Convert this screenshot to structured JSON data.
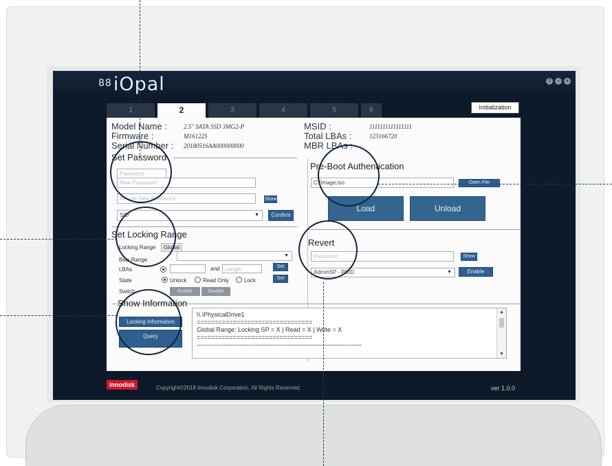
{
  "app": {
    "logo_text": "iOpal",
    "logo_glyph": "88"
  },
  "window_buttons": [
    "?",
    "−",
    "×"
  ],
  "tabs": [
    "1",
    "2",
    "3",
    "4",
    "5",
    "6"
  ],
  "initialization_label": "Initialization",
  "device_info": {
    "model_label": "Model Name :",
    "model_value": "2.5\" SATA SSD 3MG2-P",
    "firmware_label": "Firmware :",
    "firmware_value": "M161225",
    "serial_label": "Serial Number :",
    "serial_value": "20180516AA000000000",
    "msid_label": "MSID :",
    "msid_value": "1111111111111111",
    "lbas_label": "Total LBAs :",
    "lbas_value": "123166720",
    "mbr_label": "MBR LBAs :"
  },
  "set_password": {
    "title": "Set Password",
    "password_placeholder": "Password",
    "new_password_placeholder": "New Password",
    "retype_placeholder": "Retype New Password",
    "show_label": "Show",
    "authority_value": "SID",
    "confirm_label": "Confirm"
  },
  "pre_boot": {
    "title": "Pre-Boot Authentication",
    "path_value": "C:/Image.iso",
    "open_file_label": "Open File",
    "load_label": "Load",
    "unload_label": "Unload"
  },
  "locking_range": {
    "title": "Set Locking Range",
    "range_label": "Locking Range",
    "range_value": "Global",
    "bias_label": "Bias Range",
    "lbas_label": "LBAs",
    "and_label": "and",
    "length_placeholder": "Length",
    "set_label": "Set",
    "state_label": "State",
    "state_options": [
      "Unlock",
      "Read Only",
      "Lock"
    ],
    "switch_label": "Switch",
    "enable_label": "Enable",
    "disable_label": "Disable"
  },
  "revert": {
    "title": "Revert",
    "password_placeholder": "Password",
    "show_label": "Show",
    "mode_value": "AdminSP - PSID",
    "enable_label": "Enable"
  },
  "show_information": {
    "title": "Show Information",
    "locking_info_label": "Locking Information",
    "query_label": "Query"
  },
  "output_lines": [
    "\\\\.\\PhysicalDrive1",
    "================================",
    "Global Range: Locking SP = X | Read = X | Write = X",
    "================================",
    "--------------------------------------------------------------------------------"
  ],
  "footer": {
    "brand": "innodisk",
    "copyright": "Copyright©2018 Innodisk Corporation. All Rights Reserved.",
    "version": "ver 1.0.0"
  }
}
